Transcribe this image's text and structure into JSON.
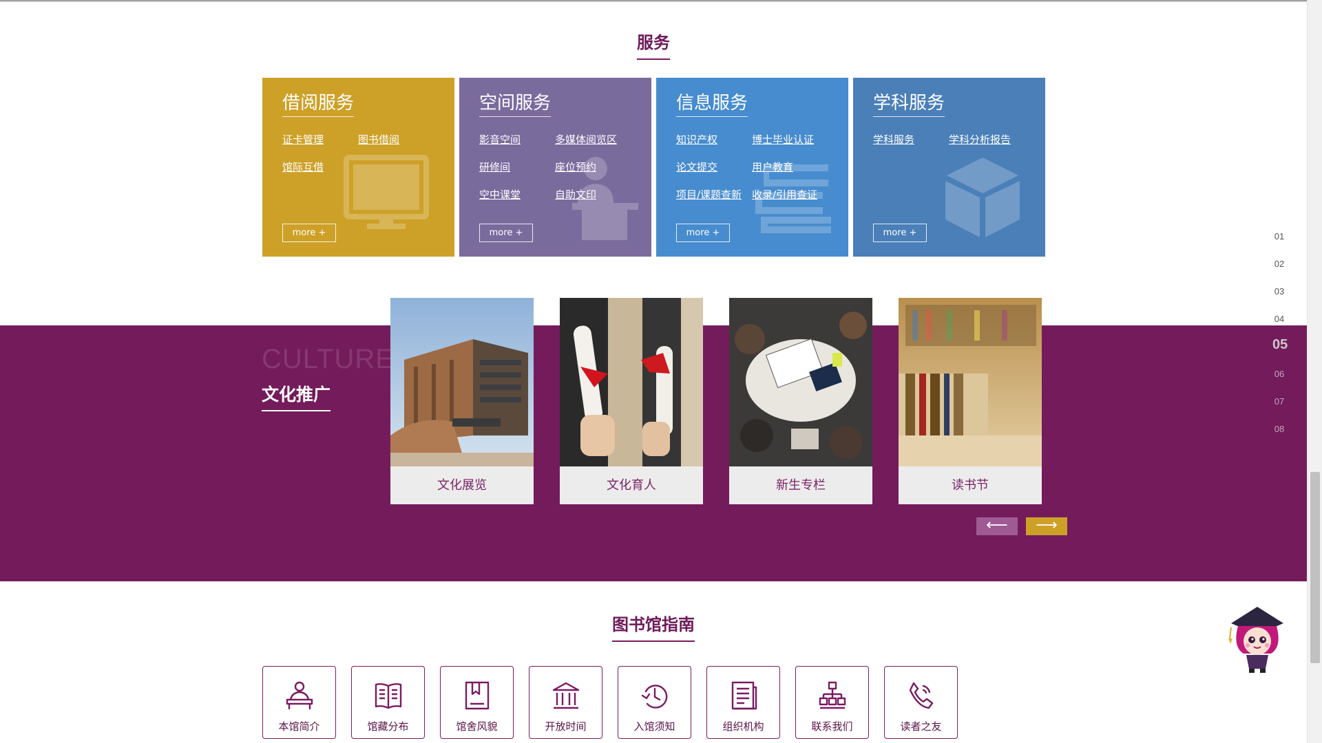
{
  "services": {
    "title": "服务",
    "cards": [
      {
        "title": "借阅服务",
        "color": "#cda128",
        "links": [
          "证卡管理",
          "图书借阅",
          "馆际互借"
        ],
        "more": "more +",
        "icon": "monitor-icon"
      },
      {
        "title": "空间服务",
        "color": "#7a6b9d",
        "links": [
          "影音空间",
          "多媒体阅览区",
          "研修间",
          "座位预约",
          "空中课堂",
          "自助文印"
        ],
        "more": "more +",
        "icon": "speaker-podium-icon"
      },
      {
        "title": "信息服务",
        "color": "#478cce",
        "links": [
          "知识产权",
          "博士毕业认证",
          "论文提交",
          "用户教育",
          "项目/课题查新",
          "收录/引用查证"
        ],
        "more": "more +",
        "icon": "stacked-books-icon"
      },
      {
        "title": "学科服务",
        "color": "#4a7fb8",
        "links": [
          "学科服务",
          "学科分析报告"
        ],
        "more": "more +",
        "icon": "cube-icon"
      }
    ]
  },
  "culture": {
    "en_title": "CULTURE",
    "zh_title": "文化推广",
    "items": [
      "文化展览",
      "文化育人",
      "新生专栏",
      "读书节"
    ],
    "band_color": "#741b5b",
    "prev_label": "⟵",
    "next_label": "⟶"
  },
  "page_nav": [
    "01",
    "02",
    "03",
    "04",
    "05",
    "06",
    "07",
    "08"
  ],
  "guide": {
    "title": "图书馆指南",
    "items": [
      {
        "label": "本馆简介",
        "icon": "librarian-desk-icon"
      },
      {
        "label": "馆藏分布",
        "icon": "open-book-icon"
      },
      {
        "label": "馆舍风貌",
        "icon": "bookmark-book-icon"
      },
      {
        "label": "开放时间",
        "icon": "building-icon"
      },
      {
        "label": "入馆须知",
        "icon": "clock-icon"
      },
      {
        "label": "组织机构",
        "icon": "document-icon"
      },
      {
        "label": "联系我们",
        "icon": "org-chart-icon"
      },
      {
        "label": "读者之友",
        "icon": "phone-icon"
      }
    ]
  }
}
